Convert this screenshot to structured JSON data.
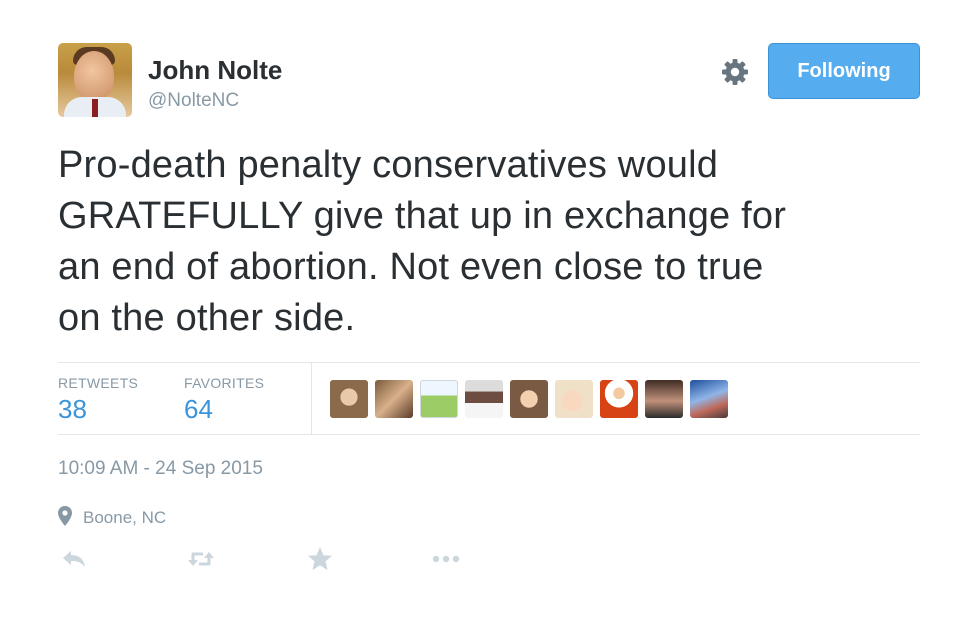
{
  "user": {
    "name": "John Nolte",
    "handle": "@NolteNC"
  },
  "follow_button": {
    "label": "Following"
  },
  "tweet": {
    "lines": [
      "Pro-death penalty conservatives would",
      "GRATEFULLY give that up in exchange for",
      "an end of abortion. Not even close to true",
      "on the other side."
    ]
  },
  "stats": {
    "retweets_label": "RETWEETS",
    "retweets_value": "38",
    "favorites_label": "FAVORITES",
    "favorites_value": "64"
  },
  "timestamp": "10:09 AM - 24 Sep 2015",
  "location": "Boone, NC",
  "colors": {
    "accent": "#55acee",
    "link": "#3b94d9",
    "muted": "#8899a6",
    "divider": "#e1e8ed"
  },
  "icons": [
    "gear-icon",
    "location-pin-icon",
    "reply-icon",
    "retweet-icon",
    "favorite-star-icon",
    "more-dots-icon"
  ]
}
